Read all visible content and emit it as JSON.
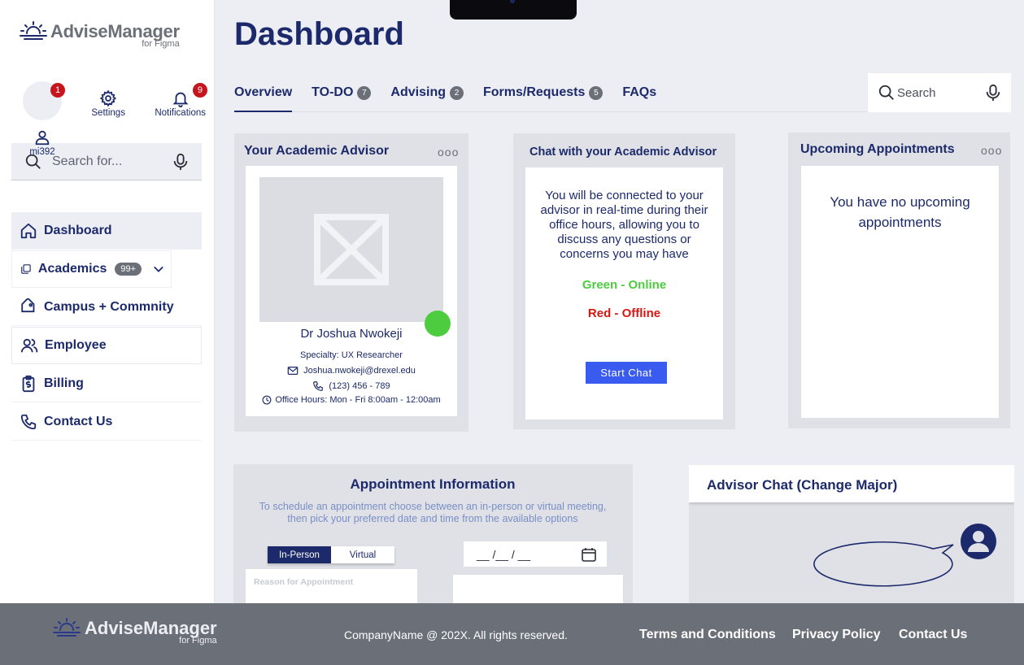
{
  "app": {
    "name": "AdviseManager",
    "sub": "for Figma"
  },
  "quick": {
    "profile": {
      "label": "mi392",
      "badge": "1"
    },
    "settings": {
      "label": "Settings"
    },
    "notifications": {
      "label": "Notifications",
      "badge": "9"
    }
  },
  "sidebar_search": {
    "placeholder": "Search for..."
  },
  "nav": [
    {
      "label": "Dashboard"
    },
    {
      "label": "Academics",
      "badge": "99+"
    },
    {
      "label": "Campus + Commnity"
    },
    {
      "label": "Employee"
    },
    {
      "label": "Billing"
    },
    {
      "label": "Contact Us"
    }
  ],
  "page": {
    "title": "Dashboard"
  },
  "tabs": [
    {
      "label": "Overview"
    },
    {
      "label": "TO-DO",
      "count": "7"
    },
    {
      "label": "Advising",
      "count": "2"
    },
    {
      "label": "Forms/Requests",
      "count": "5"
    },
    {
      "label": "FAQs"
    }
  ],
  "top_search": {
    "placeholder": "Search"
  },
  "advisor_card": {
    "title": "Your Academic Advisor",
    "menu": "ooo",
    "name": "Dr Joshua Nwokeji",
    "specialty": "Specialty: UX Researcher",
    "email": "Joshua.nwokeji@drexel.edu",
    "phone": "(123) 456 - 789",
    "hours": "Office Hours: Mon - Fri 8:00am - 12:00am",
    "status_color": "#4ccc3e"
  },
  "chat_card": {
    "title": "Chat with your Academic Advisor",
    "text": "You will be connected to your advisor in real-time during their office hours, allowing you to discuss any questions or concerns you may have",
    "green": "Green - Online",
    "red": "Red - Offline",
    "button": "Start Chat"
  },
  "appointments_card": {
    "title": "Upcoming Appointments",
    "menu": "ooo",
    "empty": "You have no upcoming appointments"
  },
  "appointment_info": {
    "title": "Appointment Information",
    "description": "To schedule an appointment choose between an in-person or virtual meeting, then pick your preferred date and time from the available options",
    "toggle_in_person": "In-Person",
    "toggle_virtual": "Virtual",
    "reason_placeholder": "Reason for Appointment",
    "date_placeholder": "__ /__ / __"
  },
  "advisor_chat": {
    "title": "Advisor Chat (Change Major)"
  },
  "footer": {
    "copyright": "CompanyName @ 202X. All rights reserved.",
    "terms": "Terms and Conditions",
    "privacy": "Privacy Policy",
    "contact": "Contact Us"
  },
  "colors": {
    "primary": "#1c2a6b",
    "accent_blue": "#3a5bf0",
    "online": "#4ccc3e",
    "offline": "#d9160f",
    "badge": "#c4161c",
    "footer": "#6b7078"
  }
}
